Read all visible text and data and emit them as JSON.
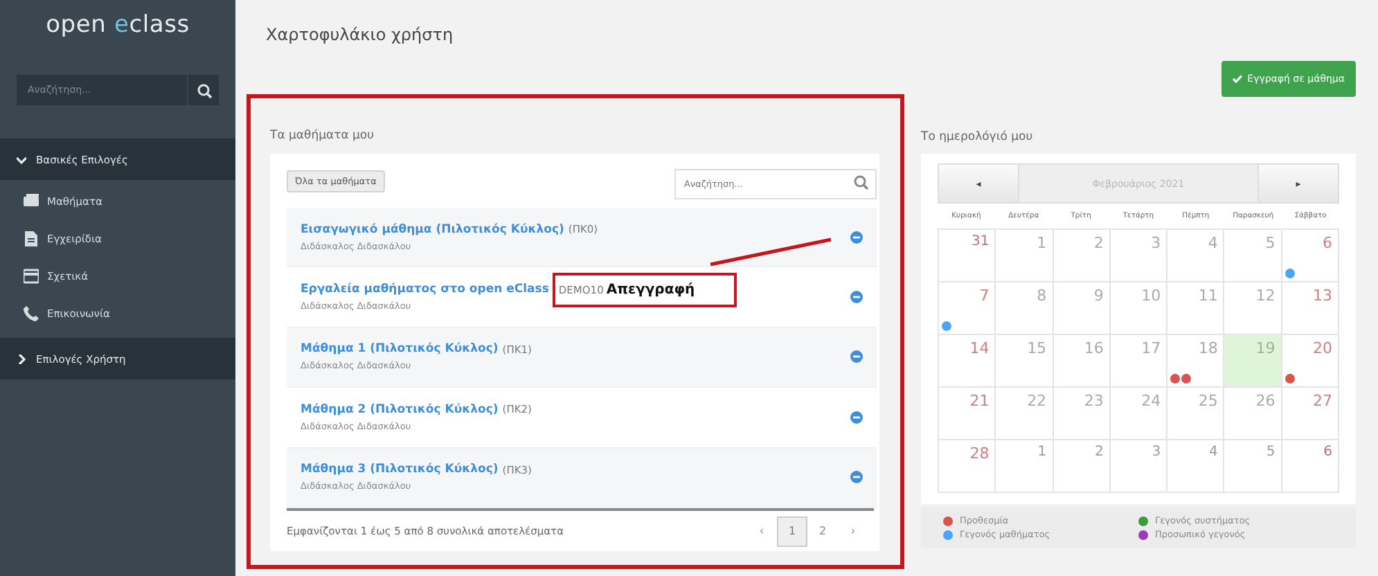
{
  "sidebar": {
    "logo": {
      "prefix": "open ",
      "accent": "e",
      "suffix": "class"
    },
    "search": {
      "placeholder": "Αναζήτηση..."
    },
    "sections": [
      {
        "label": "Βασικές Επιλογές",
        "expanded": true,
        "items": [
          {
            "label": "Μαθήματα",
            "kind": "books"
          },
          {
            "label": "Εγχειρίδια",
            "kind": "document"
          },
          {
            "label": "Σχετικά",
            "kind": "card"
          },
          {
            "label": "Επικοινωνία",
            "kind": "phone"
          }
        ]
      },
      {
        "label": "Επιλογές Χρήστη",
        "expanded": false
      }
    ]
  },
  "page": {
    "title": "Χαρτοφυλάκιο χρήστη",
    "register_button": "Εγγραφή σε μάθημα"
  },
  "courses": {
    "heading": "Τα μαθήματα μου",
    "all_button": "Όλα τα μαθήματα",
    "search": {
      "placeholder": "Αναζήτηση..."
    },
    "rows": [
      {
        "title": "Εισαγωγικό μάθημα (Πιλοτικός Κύκλος)",
        "code": "(ΠΚ0)",
        "teacher": "Διδάσκαλος Διδασκάλου"
      },
      {
        "title": "Εργαλεία μαθήματος στο open eClass",
        "code": "DEMO10",
        "teacher": "Διδάσκαλος Διδασκάλου",
        "callout": "Απεγγραφή"
      },
      {
        "title": "Μάθημα 1 (Πιλοτικός Κύκλος)",
        "code": "(ΠΚ1)",
        "teacher": "Διδάσκαλος Διδασκάλου"
      },
      {
        "title": "Μάθημα 2 (Πιλοτικός Κύκλος)",
        "code": "(ΠΚ2)",
        "teacher": "Διδάσκαλος Διδασκάλου"
      },
      {
        "title": "Μάθημα 3 (Πιλοτικός Κύκλος)",
        "code": "(ΠΚ3)",
        "teacher": "Διδάσκαλος Διδασκάλου"
      }
    ],
    "footer": "Εμφανίζονται 1 έως 5 από 8 συνολικά αποτελέσματα",
    "prev": "‹",
    "next": "›",
    "pages": [
      {
        "label": "1",
        "selected": true
      },
      {
        "label": "2",
        "selected": false
      }
    ]
  },
  "calendar": {
    "heading": "Το ημερολόγιό μου",
    "month": "Φεβρουάριος 2021",
    "prev": "◂",
    "next": "▸",
    "weekdays": [
      "Κυριακή",
      "Δευτέρα",
      "Τρίτη",
      "Τετάρτη",
      "Πέμπτη",
      "Παρασκευή",
      "Σάββατο"
    ],
    "weeks": [
      [
        {
          "day": "31",
          "outside": true,
          "today": false
        },
        {
          "day": "1",
          "outside": false,
          "today": false
        },
        {
          "day": "2",
          "outside": false,
          "today": false
        },
        {
          "day": "3",
          "outside": false,
          "today": false
        },
        {
          "day": "4",
          "outside": false,
          "today": false
        },
        {
          "day": "5",
          "outside": false,
          "today": false
        },
        {
          "day": "6",
          "outside": false,
          "today": false,
          "events": [
            {
              "color": "#4da3f5"
            }
          ]
        }
      ],
      [
        {
          "day": "7",
          "outside": false,
          "today": false,
          "events": [
            {
              "color": "#4da3f5"
            }
          ]
        },
        {
          "day": "8",
          "outside": false,
          "today": false
        },
        {
          "day": "9",
          "outside": false,
          "today": false
        },
        {
          "day": "10",
          "outside": false,
          "today": false
        },
        {
          "day": "11",
          "outside": false,
          "today": false
        },
        {
          "day": "12",
          "outside": false,
          "today": false
        },
        {
          "day": "13",
          "outside": false,
          "today": false
        }
      ],
      [
        {
          "day": "14",
          "outside": false,
          "today": false
        },
        {
          "day": "15",
          "outside": false,
          "today": false
        },
        {
          "day": "16",
          "outside": false,
          "today": false
        },
        {
          "day": "17",
          "outside": false,
          "today": false
        },
        {
          "day": "18",
          "outside": false,
          "today": false,
          "events": [
            {
              "color": "#d9534f"
            },
            {
              "color": "#d9534f"
            }
          ]
        },
        {
          "day": "19",
          "outside": false,
          "today": true
        },
        {
          "day": "20",
          "outside": false,
          "today": false,
          "events": [
            {
              "color": "#d9534f"
            }
          ]
        }
      ],
      [
        {
          "day": "21",
          "outside": false,
          "today": false
        },
        {
          "day": "22",
          "outside": false,
          "today": false
        },
        {
          "day": "23",
          "outside": false,
          "today": false
        },
        {
          "day": "24",
          "outside": false,
          "today": false
        },
        {
          "day": "25",
          "outside": false,
          "today": false
        },
        {
          "day": "26",
          "outside": false,
          "today": false
        },
        {
          "day": "27",
          "outside": false,
          "today": false
        }
      ],
      [
        {
          "day": "28",
          "outside": false,
          "today": false
        },
        {
          "day": "1",
          "outside": true,
          "today": false
        },
        {
          "day": "2",
          "outside": true,
          "today": false
        },
        {
          "day": "3",
          "outside": true,
          "today": false
        },
        {
          "day": "4",
          "outside": true,
          "today": false
        },
        {
          "day": "5",
          "outside": true,
          "today": false
        },
        {
          "day": "6",
          "outside": true,
          "today": false
        }
      ]
    ],
    "legend": [
      {
        "label": "Προθεσμία",
        "color": "#d9534f"
      },
      {
        "label": "Γεγονός συστήματος",
        "color": "#3d9a3d"
      },
      {
        "label": "Γεγονός μαθήματος",
        "color": "#4da3f5"
      },
      {
        "label": "Προσωπικό γεγονός",
        "color": "#9c3cb8"
      }
    ]
  }
}
